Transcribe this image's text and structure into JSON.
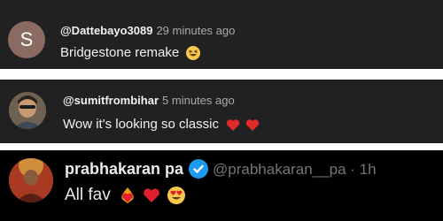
{
  "comments": [
    {
      "avatar_letter": "S",
      "handle": "@Dattebayo3089",
      "time": "29 minutes ago",
      "text": "Bridgestone remake",
      "emoji": "grinning-squint-emoji"
    },
    {
      "handle": "@sumitfrombihar",
      "time": "5 minutes ago",
      "text": "Wow it's looking so classic",
      "emoji": [
        "red-heart-emoji",
        "red-heart-emoji"
      ]
    }
  ],
  "tweet": {
    "name": "prabhakaran pa",
    "handle_time": "@prabhakaran__pa · 1h",
    "text": "All fav",
    "emoji": [
      "heart-on-fire-emoji",
      "red-heart-emoji",
      "heart-eyes-emoji"
    ]
  },
  "colors": {
    "card_bg": "#212121",
    "tweet_bg": "#000000",
    "verified": "#1d9bf0",
    "heart": "#e0245e"
  }
}
